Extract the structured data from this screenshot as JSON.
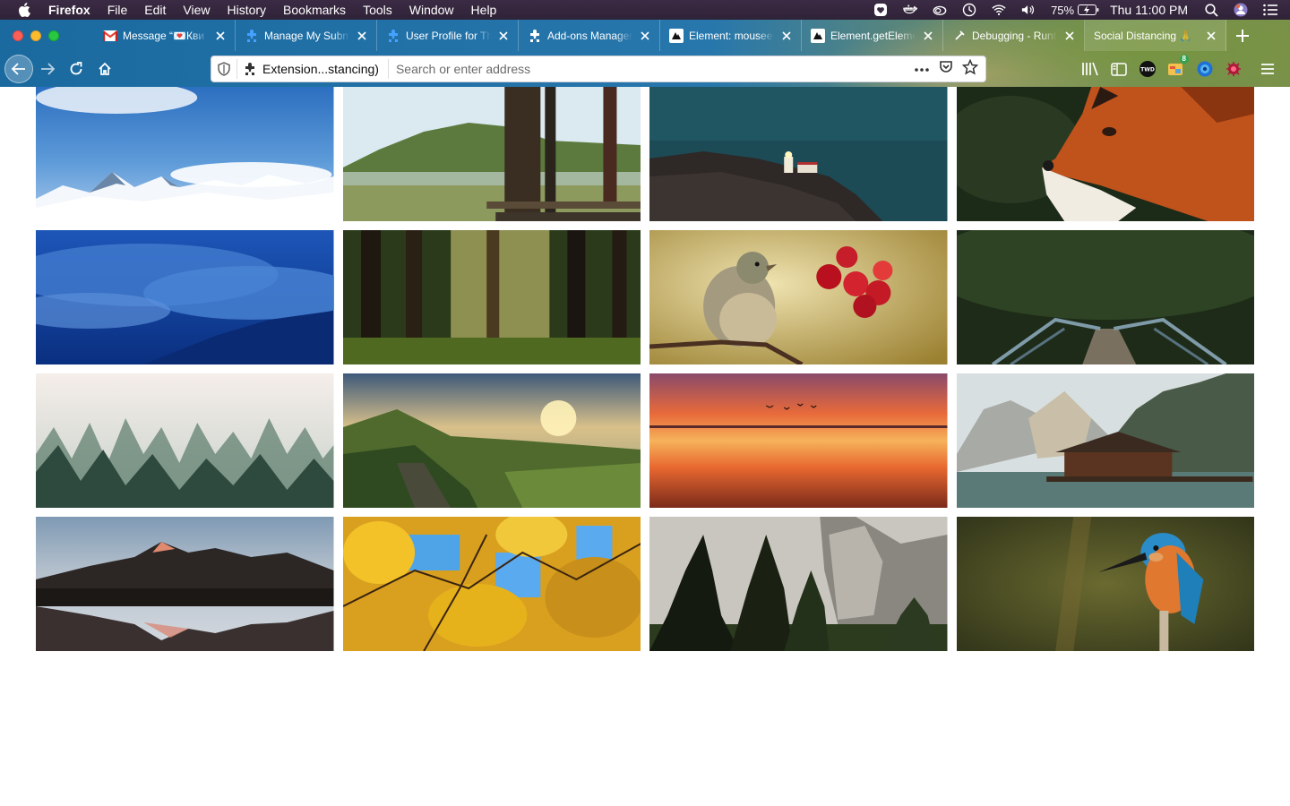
{
  "menubar": {
    "app_name": "Firefox",
    "items": [
      "File",
      "Edit",
      "View",
      "History",
      "Bookmarks",
      "Tools",
      "Window",
      "Help"
    ],
    "battery": "75%",
    "clock": "Thu 11:00 PM"
  },
  "tabs": [
    {
      "title": "Message “💌Кви",
      "icon": "gmail-icon"
    },
    {
      "title": "Manage My Submissions",
      "icon": "puzzle-icon"
    },
    {
      "title": "User Profile for The",
      "icon": "puzzle-icon"
    },
    {
      "title": "Add-ons Manager",
      "icon": "addons-icon"
    },
    {
      "title": "Element: mouseenter",
      "icon": "mdn-icon"
    },
    {
      "title": "Element.getElementsBy",
      "icon": "mdn-icon"
    },
    {
      "title": "Debugging - Runtime",
      "icon": "debug-icon"
    },
    {
      "title": "Social Distancing 🙏",
      "icon": ""
    }
  ],
  "urlbar": {
    "extension_label": "Extension...stancing)",
    "placeholder": "Search or enter address"
  },
  "toolbar": {
    "badge_count": "8",
    "twd_label": "TWD"
  },
  "gallery": [
    {
      "name": "snowy-mountains-tile"
    },
    {
      "name": "misty-lake-dock-tile"
    },
    {
      "name": "lighthouse-coast-tile"
    },
    {
      "name": "red-fox-tile"
    },
    {
      "name": "blue-clouds-mountain-tile"
    },
    {
      "name": "sunlit-forest-tile"
    },
    {
      "name": "bird-red-berries-tile"
    },
    {
      "name": "forest-bridge-tile"
    },
    {
      "name": "foggy-pine-forest-tile"
    },
    {
      "name": "green-cliffs-sunset-tile"
    },
    {
      "name": "orange-sunset-beach-tile"
    },
    {
      "name": "lake-cabin-mountains-tile"
    },
    {
      "name": "mountain-lake-reflection-tile"
    },
    {
      "name": "yellow-autumn-leaves-tile"
    },
    {
      "name": "yosemite-cliff-tile"
    },
    {
      "name": "kingfisher-tile"
    }
  ]
}
